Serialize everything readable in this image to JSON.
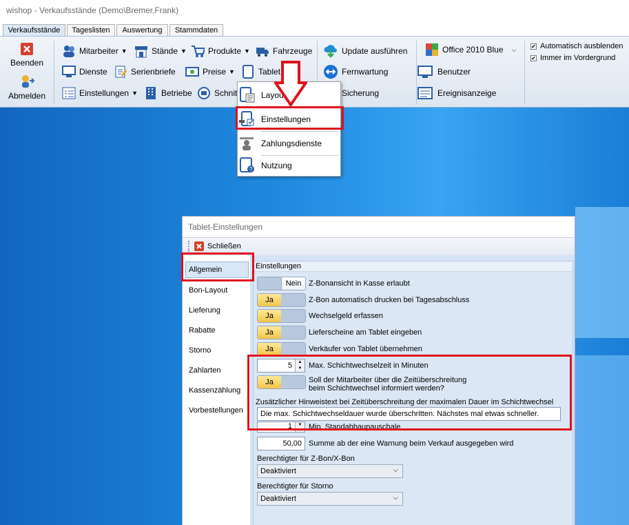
{
  "window": {
    "title": "wishop - Verkaufsstände (Demo\\Bremer,Frank)"
  },
  "tabs": [
    "Verkaufsstände",
    "Tageslisten",
    "Auswertung",
    "Stammdaten"
  ],
  "ribbon": {
    "beenden": "Beenden",
    "abmelden": "Abmelden",
    "mitarbeiter": "Mitarbeiter",
    "staende": "Stände",
    "produkte": "Produkte",
    "fahrzeuge": "Fahrzeuge",
    "dienste": "Dienste",
    "serienbriefe": "Serienbriefe",
    "preise": "Preise",
    "tablet": "Tablet",
    "einstellungen": "Einstellungen",
    "betriebe": "Betriebe",
    "schnittstellen": "Schnitt",
    "update": "Update ausführen",
    "fernwartung": "Fernwartung",
    "sicherung": "Sicherung",
    "theme": "Office 2010 Blue",
    "benutzer": "Benutzer",
    "ereignisanzeige": "Ereignisanzeige",
    "auto_hide": "Automatisch ausblenden",
    "always_top": "Immer im Vordergrund"
  },
  "menu": {
    "items": [
      "Layout",
      "Einstellungen",
      "Zahlungsdienste",
      "Nutzung"
    ]
  },
  "dialog": {
    "title": "Tablet-Einstellungen",
    "close": "Schließen",
    "nav": [
      "Allgemein",
      "Bon-Layout",
      "Lieferung",
      "Rabatte",
      "Storno",
      "Zahlarten",
      "Kassenzählung",
      "Vorbestellungen"
    ],
    "group": "Einstellungen",
    "yes": "Ja",
    "no": "Nein",
    "opt1": "Z-Bonansicht in Kasse erlaubt",
    "opt2": "Z-Bon automatisch drucken bei Tagesabschluss",
    "opt3": "Wechselgeld erfassen",
    "opt4": "Lieferscheine am Tablet eingeben",
    "opt5": "Verkäufer von Tablet übernehmen",
    "shift_value": "5",
    "shift_label": "Max. Schichtwechselzeit in Minuten",
    "notify_l1": "Soll der Mitarbeiter über die Zeitüberschreitung",
    "notify_l2": "beim Schichtwechsel informiert werden?",
    "hint_label": "Zusätzlicher Hinweistext bei Zeitüberschreitung der maximalen Dauer im Schichtwechsel",
    "hint_value": "Die max. Schichtwechseldauer wurde überschritten. Nächstes mal etwas schneller.",
    "abbau_value": "1",
    "abbau_label": "Min. Standabbaupauschale",
    "warn_value": "50,00",
    "warn_label": "Summe ab der eine Warnung beim Verkauf ausgegeben wird",
    "zbon_label": "Berechtigter für Z-Bon/X-Bon",
    "zbon_value": "Deaktiviert",
    "storno_label": "Berechtigter für Storno",
    "storno_value": "Deaktiviert"
  },
  "colors": {
    "highlight": "#e0101e",
    "desktop": "#1f8ae0"
  }
}
